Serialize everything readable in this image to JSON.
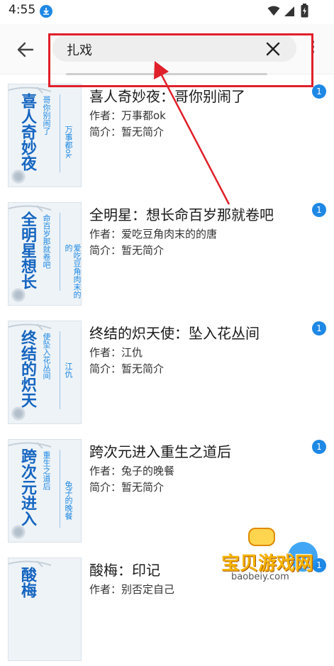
{
  "status_bar": {
    "time": "4:55"
  },
  "search": {
    "query": "扎戏"
  },
  "results": [
    {
      "title": "喜人奇妙夜：哥你别闹了",
      "author_line": "作者：万事都ok",
      "intro_line": "简介：暂无简介",
      "badge": "1",
      "cover_title": "喜人奇妙夜",
      "cover_sub": "哥你别闹了",
      "cover_author": "万事都ok"
    },
    {
      "title": "全明星：想长命百岁那就卷吧",
      "author_line": "作者：爱吃豆角肉末的的唐",
      "intro_line": "简介：暂无简介",
      "badge": "1",
      "cover_title": "全明星想长",
      "cover_sub": "命百岁那就卷吧",
      "cover_author": "爱吃豆角肉末的的"
    },
    {
      "title": "终结的炽天使：坠入花丛间",
      "author_line": "作者：江仇",
      "intro_line": "简介：暂无简介",
      "badge": "1",
      "cover_title": "终结的炽天",
      "cover_sub": "使坠入花丛间",
      "cover_author": "江仇"
    },
    {
      "title": "跨次元进入重生之道后",
      "author_line": "作者：兔子的晚餐",
      "intro_line": "简介：暂无简介",
      "badge": "1",
      "cover_title": "跨次元进入",
      "cover_sub": "重生之道后",
      "cover_author": "兔子的晚餐"
    },
    {
      "title": "酸梅：印记",
      "author_line": "作者：别否定自己",
      "intro_line": "",
      "badge": "1",
      "cover_title": "酸梅",
      "cover_sub": "",
      "cover_author": ""
    }
  ],
  "watermark": {
    "text": "宝贝游戏网",
    "url": "baobeiy.com"
  },
  "colors": {
    "accent": "#1e88e5",
    "annotation": "#e0202a",
    "cover_title": "#1565c0"
  }
}
